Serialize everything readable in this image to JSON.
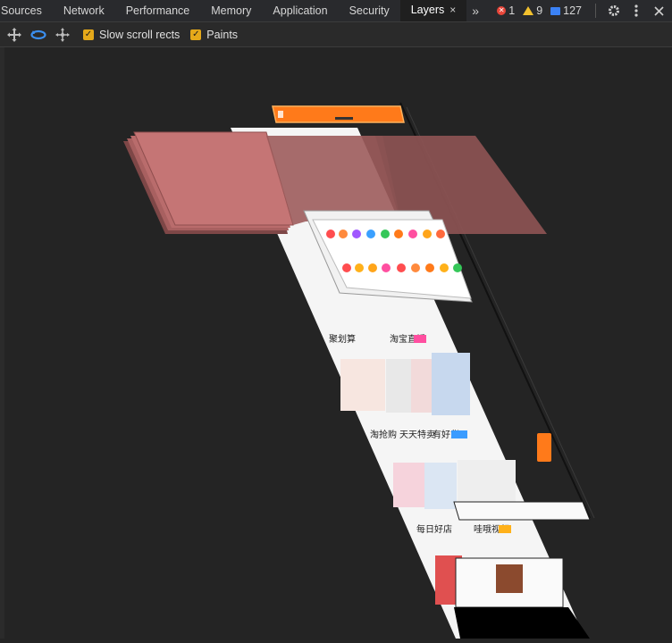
{
  "tabs": [
    {
      "label": "Sources",
      "active": false
    },
    {
      "label": "Network",
      "active": false
    },
    {
      "label": "Performance",
      "active": false
    },
    {
      "label": "Memory",
      "active": false
    },
    {
      "label": "Application",
      "active": false
    },
    {
      "label": "Security",
      "active": false
    },
    {
      "label": "Layers",
      "active": true
    }
  ],
  "tab_close_glyph": "×",
  "more_tabs_glyph": "»",
  "status": {
    "errors": "1",
    "warnings": "9",
    "messages": "127"
  },
  "toolbar": {
    "checkboxes": [
      {
        "label": "Slow scroll rects",
        "checked": true
      },
      {
        "label": "Paints",
        "checked": true
      }
    ]
  },
  "canvas": {
    "content_text": {
      "l1": "聚划算",
      "l2": "淘宝直播",
      "l3": "淘抢购",
      "l4": "天天特卖",
      "l5": "有好货",
      "l6": "每日好店",
      "l7": "哇哦视频"
    }
  },
  "colors": {
    "accent": "#e5a91a",
    "layer_fill": "#b96c6c",
    "highlight": "#ff7a1a"
  }
}
